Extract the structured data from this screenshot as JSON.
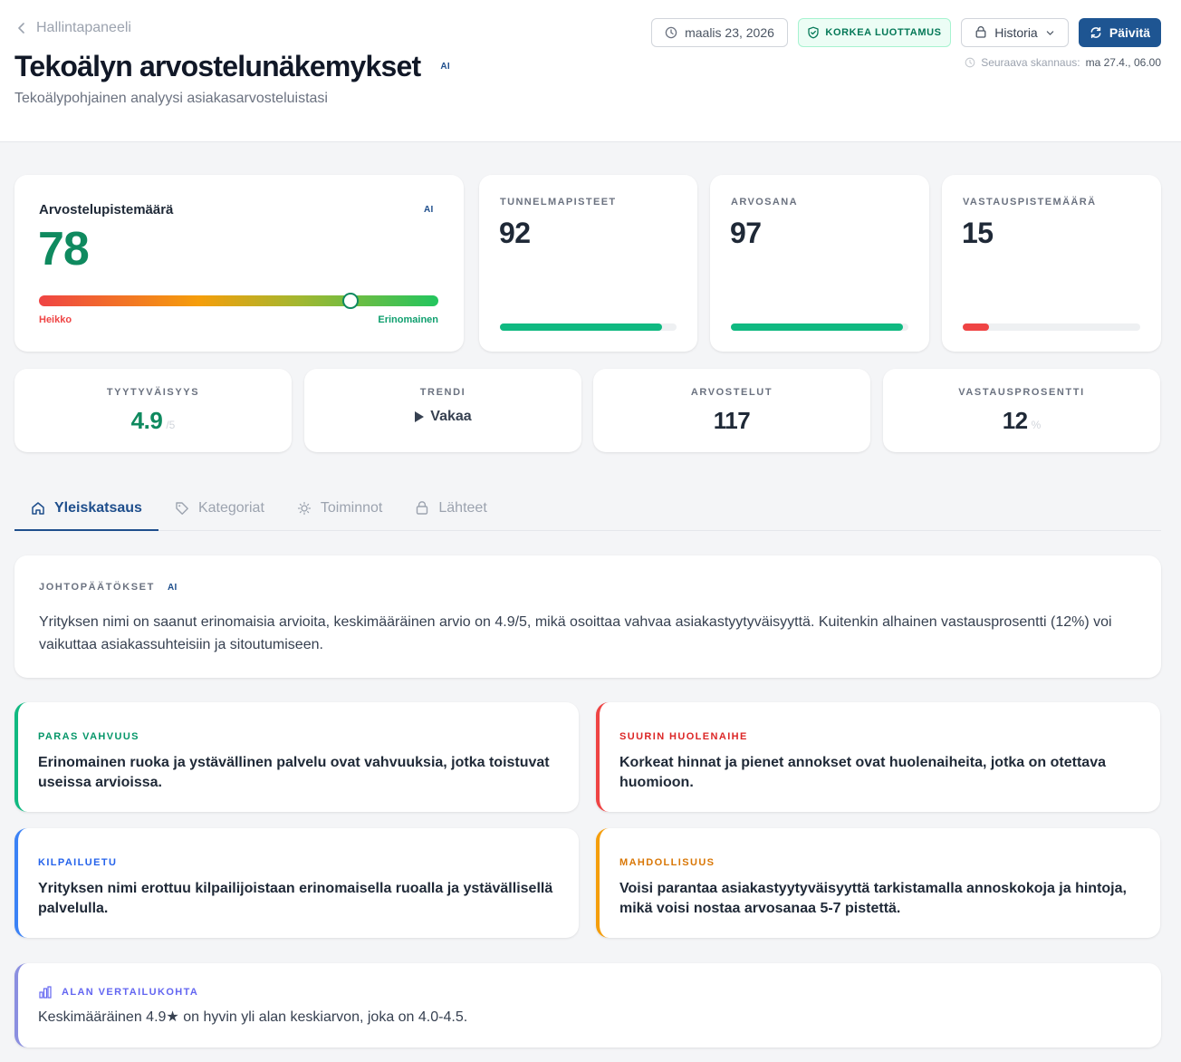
{
  "header": {
    "back_label": "Hallintapaneeli",
    "title": "Tekoälyn arvostelunäkemykset",
    "ai_tag": "AI",
    "subtitle": "Tekoälypohjainen analyysi asiakasarvosteluistasi",
    "date_label": "maalis 23, 2026",
    "confidence_label": "KORKEA LUOTTAMUS",
    "history_label": "Historia",
    "update_label": "Päivitä",
    "next_scan_label": "Seuraava skannaus:",
    "next_scan_value": "ma 27.4., 06.00"
  },
  "score": {
    "label": "Arvostelupistemäärä",
    "ai_tag": "AI",
    "value": "78",
    "value_fraction": 0.78,
    "low_label": "Heikko",
    "high_label": "Erinomainen"
  },
  "metrics": [
    {
      "label": "TUNNELMAPISTEET",
      "value": "92",
      "fill_percent": 92,
      "color": "#10b981"
    },
    {
      "label": "ARVOSANA",
      "value": "97",
      "fill_percent": 97,
      "color": "#10b981"
    },
    {
      "label": "VASTAUSPISTEMÄÄRÄ",
      "value": "15",
      "fill_percent": 15,
      "color": "#ef4444"
    }
  ],
  "stats": {
    "satisfaction": {
      "label": "TYYTYVÄISYYS",
      "value": "4.9",
      "unit": "/5"
    },
    "trend": {
      "label": "TRENDI",
      "value": "Vakaa",
      "icon": "triangle-right-icon"
    },
    "reviews": {
      "label": "ARVOSTELUT",
      "value": "117"
    },
    "response_rate": {
      "label": "VASTAUSPROSENTTI",
      "value": "12",
      "unit": "%"
    }
  },
  "tabs": [
    {
      "label": "Yleiskatsaus",
      "icon": "home-icon",
      "active": true
    },
    {
      "label": "Kategoriat",
      "icon": "tag-icon",
      "active": false
    },
    {
      "label": "Toiminnot",
      "icon": "lightbulb-icon",
      "active": false
    },
    {
      "label": "Lähteet",
      "icon": "database-icon",
      "active": false
    }
  ],
  "conclusions": {
    "label": "JOHTOPÄÄTÖKSET",
    "ai_tag": "AI",
    "text": "Yrityksen nimi on saanut erinomaisia arvioita, keskimääräinen arvio on 4.9/5, mikä osoittaa vahvaa asiakastyytyväisyyttä. Kuitenkin alhainen vastausprosentti (12%) voi vaikuttaa asiakassuhteisiin ja sitoutumiseen."
  },
  "insights": {
    "strength": {
      "label": "PARAS VAHVUUS",
      "text": "Erinomainen ruoka ja ystävällinen palvelu ovat vahvuuksia, jotka toistuvat useissa arvioissa.",
      "color": "#10b981",
      "label_color": "#059669"
    },
    "concern": {
      "label": "SUURIN HUOLENAIHE",
      "text": "Korkeat hinnat ja pienet annokset ovat huolenaiheita, jotka on otettava huomioon.",
      "color": "#ef4444",
      "label_color": "#dc2626"
    },
    "advantage": {
      "label": "KILPAILUETU",
      "text": "Yrityksen nimi erottuu kilpailijoistaan erinomaisella ruoalla ja ystävällisellä palvelulla.",
      "color": "#3b82f6",
      "label_color": "#2563eb"
    },
    "opportunity": {
      "label": "MAHDOLLISUUS",
      "text": "Voisi parantaa asiakastyytyväisyyttä tarkistamalla annoskokoja ja hintoja, mikä voisi nostaa arvosanaa 5-7 pistettä.",
      "color": "#f59e0b",
      "label_color": "#d97706"
    }
  },
  "benchmark": {
    "label": "ALAN VERTAILUKOHTA",
    "icon": "bar-chart-icon",
    "text": "Keskimääräinen 4.9★ on hyvin yli alan keskiarvon, joka on 4.0-4.5."
  }
}
